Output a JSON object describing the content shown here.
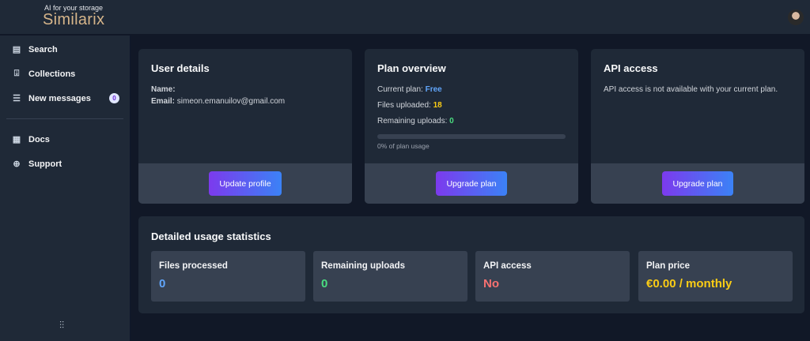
{
  "header": {
    "logo_tagline": "AI for your storage",
    "logo_name": "Similarix"
  },
  "sidebar": {
    "items": [
      {
        "label": "Search"
      },
      {
        "label": "Collections"
      },
      {
        "label": "New messages",
        "badge": "0"
      },
      {
        "label": "Docs"
      },
      {
        "label": "Support"
      }
    ]
  },
  "user_details": {
    "title": "User details",
    "name_label": "Name:",
    "name_value": "",
    "email_label": "Email:",
    "email_value": "simeon.emanuilov@gmail.com",
    "button": "Update profile"
  },
  "plan_overview": {
    "title": "Plan overview",
    "current_plan_label": "Current plan:",
    "current_plan": "Free",
    "files_uploaded_label": "Files uploaded:",
    "files_uploaded": "18",
    "remaining_label": "Remaining uploads:",
    "remaining": "0",
    "usage_percent": 0,
    "usage_text": "0% of plan usage",
    "button": "Upgrade plan"
  },
  "api_access": {
    "title": "API access",
    "text": "API access is not available with your current plan.",
    "button": "Upgrade plan"
  },
  "stats": {
    "title": "Detailed usage statistics",
    "items": [
      {
        "label": "Files processed",
        "value": "0",
        "color": "#60a5fa"
      },
      {
        "label": "Remaining uploads",
        "value": "0",
        "color": "#4ade80"
      },
      {
        "label": "API access",
        "value": "No",
        "color": "#f87171"
      },
      {
        "label": "Plan price",
        "value": "€0.00 / monthly",
        "color": "#facc15"
      }
    ]
  }
}
